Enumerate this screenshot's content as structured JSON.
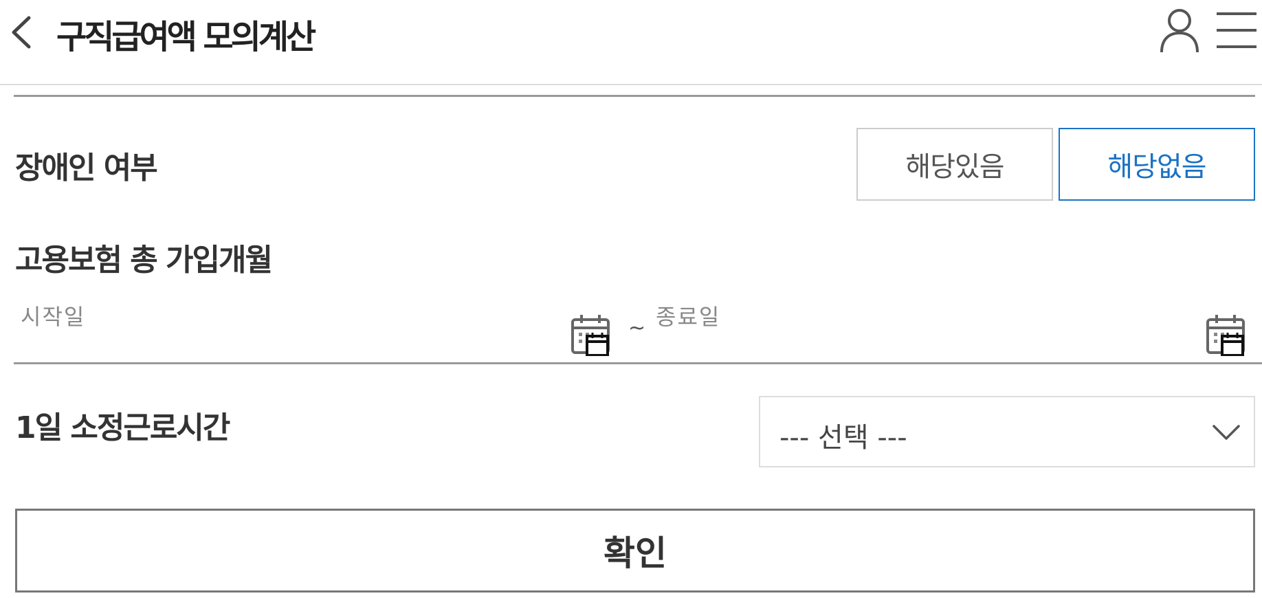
{
  "header": {
    "title": "구직급여액 모의계산",
    "back_icon": "chevron-left-icon",
    "user_icon": "user-icon",
    "menu_icon": "hamburger-menu-icon"
  },
  "disability": {
    "label": "장애인 여부",
    "options": [
      "해당있음",
      "해당없음"
    ],
    "selected": "해당없음"
  },
  "insurance_period": {
    "label": "고용보험 총 가입개월",
    "start_placeholder": "시작일",
    "separator": "~",
    "end_placeholder": "종료일",
    "calendar_icon": "calendar-icon"
  },
  "daily_hours": {
    "label": "1일 소정근로시간",
    "selected_value": "--- 선택 ---",
    "dropdown_icon": "chevron-down-icon"
  },
  "confirm_label": "확인",
  "colors": {
    "accent": "#1a72c4",
    "text": "#333333",
    "border": "#cccccc"
  }
}
